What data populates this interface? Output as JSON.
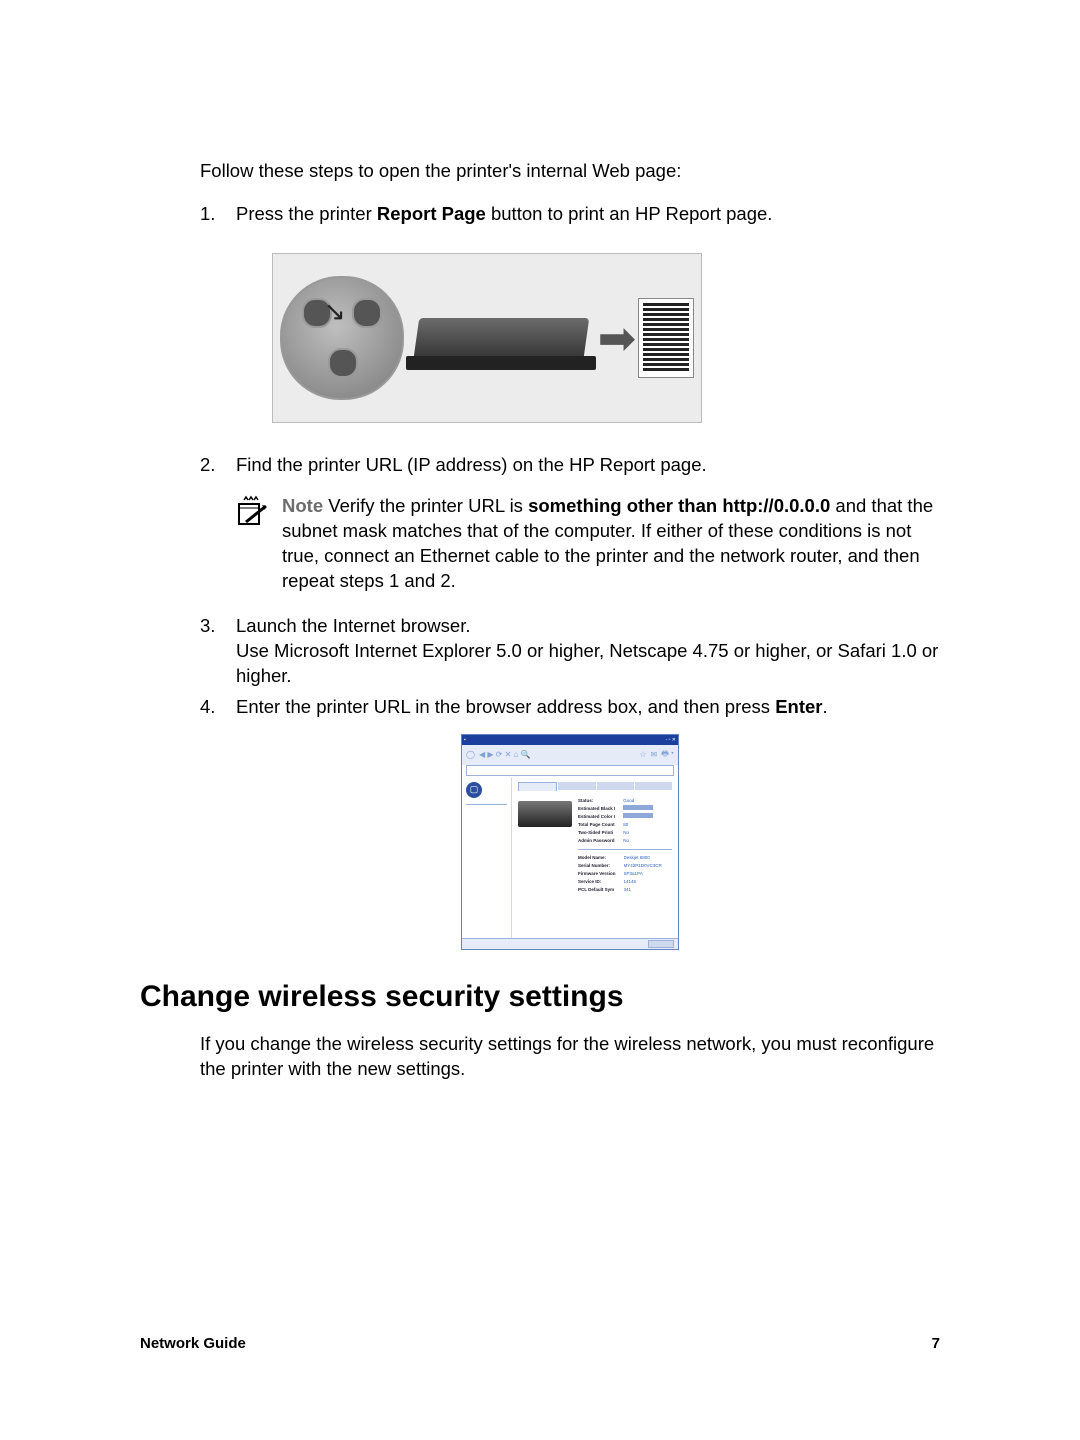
{
  "intro": "Follow these steps to open the printer's internal Web page:",
  "steps": {
    "s1": {
      "num": "1.",
      "pre": "Press the printer ",
      "bold": "Report Page",
      "post": " button to print an HP Report page."
    },
    "s2": {
      "num": "2.",
      "text": "Find the printer URL (IP address) on the HP Report page."
    },
    "note": {
      "label": "Note",
      "pre": "   Verify the printer URL is ",
      "bold": "something other than http://0.0.0.0",
      "post": " and that the subnet mask matches that of the computer. If either of these conditions is not true, connect an Ethernet cable to the printer and the network router, and then repeat steps 1 and 2."
    },
    "s3": {
      "num": "3.",
      "line1": "Launch the Internet browser.",
      "line2": "Use Microsoft Internet Explorer 5.0 or higher, Netscape 4.75 or higher, or Safari 1.0 or higher."
    },
    "s4": {
      "num": "4.",
      "pre": "Enter the printer URL in the browser address box, and then press ",
      "bold": "Enter",
      "post": "."
    }
  },
  "ews": {
    "labels": [
      "Status:",
      "Estimated Black I",
      "Estimated Color I",
      "Total Page Count",
      "Two-Sided Printi",
      "Admin Password"
    ],
    "values": [
      "Good",
      "",
      "",
      "80",
      "No",
      "No"
    ],
    "labels2": [
      "Model Name:",
      "Serial Number:",
      "Firmware Version",
      "Service ID:",
      "PCL Default Sym"
    ],
    "values2": [
      "Deskjet 6800",
      "MY42P1D0VC3CR",
      "SP3a1PA",
      "14145",
      "341"
    ]
  },
  "section": "Change wireless security settings",
  "section_body": "If you change the wireless security settings for the wireless network, you must reconfigure the printer with the new settings.",
  "footer": {
    "guide": "Network Guide",
    "page": "7"
  }
}
